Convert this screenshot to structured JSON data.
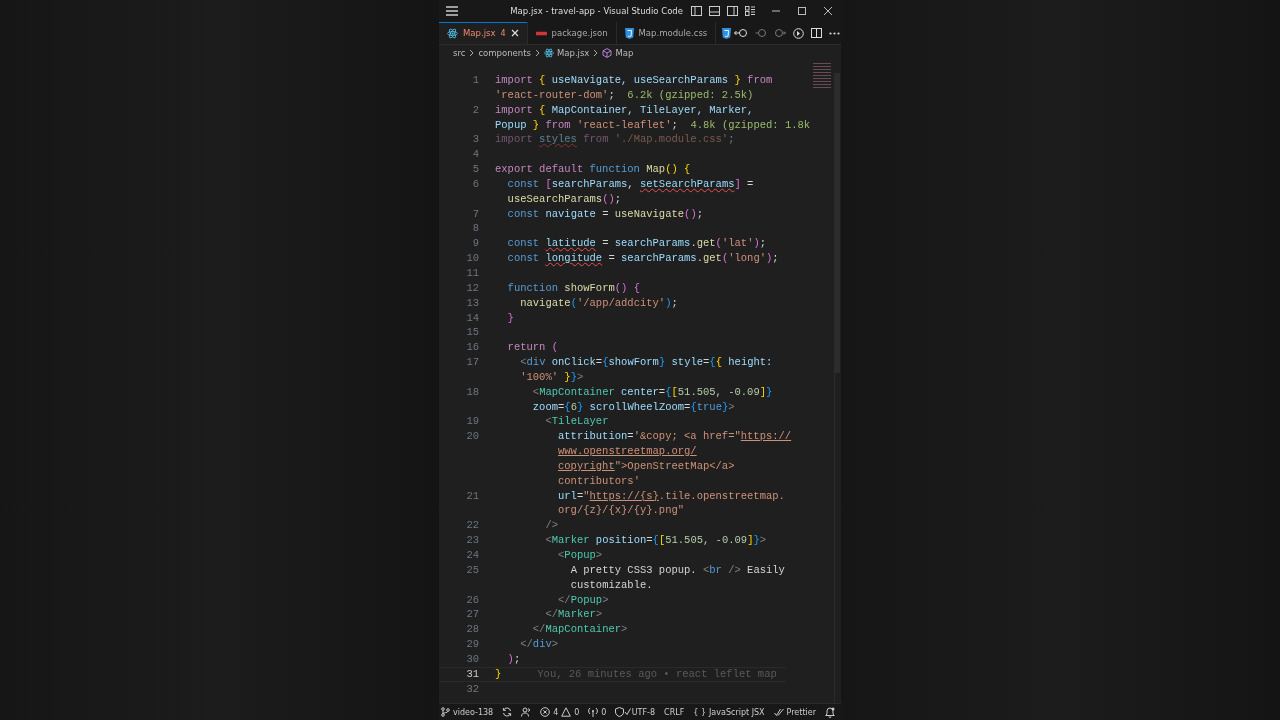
{
  "window": {
    "title": "Map.jsx - travel-app - Visual Studio Code"
  },
  "tabs": [
    {
      "label": "Map.jsx",
      "badge": "4",
      "kind": "jsx",
      "selected": true
    },
    {
      "label": "package.json",
      "kind": "json",
      "selected": false
    },
    {
      "label": "Map.module.css",
      "kind": "css",
      "selected": false
    },
    {
      "kind": "css",
      "selected": false
    }
  ],
  "breadcrumb": [
    {
      "text": "src",
      "kind": "folder"
    },
    {
      "text": "components",
      "kind": "folder"
    },
    {
      "text": "Map.jsx",
      "kind": "jsx"
    },
    {
      "text": "Map",
      "kind": "symbol"
    }
  ],
  "lines": [
    {
      "number": "1",
      "current": false,
      "rows": [
        {
          "tokens": [
            {
              "text": "import ",
              "kind": "keyword"
            },
            {
              "text": "{",
              "kind": "bracket1"
            },
            {
              "text": " useNavigate, useSearchParams ",
              "kind": "variable"
            },
            {
              "text": "}",
              "kind": "bracket1"
            },
            {
              "text": " from",
              "kind": "keyword"
            }
          ]
        },
        {
          "tokens": [
            {
              "text": "'react-router-dom'",
              "kind": "string"
            },
            {
              "text": ";",
              "kind": "plain"
            },
            {
              "text": "  6.2k (gzipped: 2.5k)",
              "kind": "hint"
            }
          ]
        }
      ]
    },
    {
      "number": "2",
      "current": false,
      "rows": [
        {
          "tokens": [
            {
              "text": "import ",
              "kind": "keyword"
            },
            {
              "text": "{",
              "kind": "bracket1"
            },
            {
              "text": " MapContainer, TileLayer, Marker,",
              "kind": "variable"
            }
          ]
        },
        {
          "tokens": [
            {
              "text": "Popup ",
              "kind": "variable"
            },
            {
              "text": "}",
              "kind": "bracket1"
            },
            {
              "text": " from ",
              "kind": "keyword"
            },
            {
              "text": "'react-leaflet'",
              "kind": "string"
            },
            {
              "text": ";",
              "kind": "plain"
            },
            {
              "text": "  4.8k (gzipped: 1.8k",
              "kind": "hint"
            }
          ]
        }
      ]
    },
    {
      "number": "3",
      "current": false,
      "faded": true,
      "rows": [
        {
          "tokens": [
            {
              "text": "import ",
              "kind": "keyword"
            },
            {
              "text": "styles",
              "kind": "error"
            },
            {
              "text": " from ",
              "kind": "keyword"
            },
            {
              "text": "'./Map.module.css'",
              "kind": "string"
            },
            {
              "text": ";",
              "kind": "plain"
            }
          ]
        }
      ]
    },
    {
      "number": "4",
      "current": false
    },
    {
      "number": "5",
      "current": false,
      "rows": [
        {
          "tokens": [
            {
              "text": "export default ",
              "kind": "keyword"
            },
            {
              "text": "function ",
              "kind": "storage"
            },
            {
              "text": "Map",
              "kind": "function"
            },
            {
              "text": "()",
              "kind": "bracket1"
            },
            {
              "text": " {",
              "kind": "bracket1"
            }
          ]
        }
      ]
    },
    {
      "number": "6",
      "current": false,
      "rows": [
        {
          "tokens": [
            {
              "text": "  const ",
              "kind": "storage"
            },
            {
              "text": "[",
              "kind": "bracket2"
            },
            {
              "text": "searchParams",
              "kind": "variable"
            },
            {
              "text": ", ",
              "kind": "plain"
            },
            {
              "text": "setSearchParams",
              "kind": "error"
            },
            {
              "text": "]",
              "kind": "bracket2"
            },
            {
              "text": " =",
              "kind": "plain"
            }
          ]
        },
        {
          "tokens": [
            {
              "text": "  useSearchParams",
              "kind": "function"
            },
            {
              "text": "()",
              "kind": "bracket2"
            },
            {
              "text": ";",
              "kind": "plain"
            }
          ]
        }
      ]
    },
    {
      "number": "7",
      "current": false,
      "rows": [
        {
          "tokens": [
            {
              "text": "  const ",
              "kind": "storage"
            },
            {
              "text": "navigate",
              "kind": "variable"
            },
            {
              "text": " = ",
              "kind": "plain"
            },
            {
              "text": "useNavigate",
              "kind": "function"
            },
            {
              "text": "()",
              "kind": "bracket2"
            },
            {
              "text": ";",
              "kind": "plain"
            }
          ]
        }
      ]
    },
    {
      "number": "8",
      "current": false
    },
    {
      "number": "9",
      "current": false,
      "rows": [
        {
          "tokens": [
            {
              "text": "  const ",
              "kind": "storage"
            },
            {
              "text": "latitude",
              "kind": "error"
            },
            {
              "text": " = ",
              "kind": "plain"
            },
            {
              "text": "searchParams",
              "kind": "variable"
            },
            {
              "text": ".",
              "kind": "plain"
            },
            {
              "text": "get",
              "kind": "function"
            },
            {
              "text": "(",
              "kind": "bracket2"
            },
            {
              "text": "'lat'",
              "kind": "string"
            },
            {
              "text": ")",
              "kind": "bracket2"
            },
            {
              "text": ";",
              "kind": "plain"
            }
          ]
        }
      ]
    },
    {
      "number": "10",
      "current": false,
      "rows": [
        {
          "tokens": [
            {
              "text": "  const ",
              "kind": "storage"
            },
            {
              "text": "longitude",
              "kind": "error"
            },
            {
              "text": " = ",
              "kind": "plain"
            },
            {
              "text": "searchParams",
              "kind": "variable"
            },
            {
              "text": ".",
              "kind": "plain"
            },
            {
              "text": "get",
              "kind": "function"
            },
            {
              "text": "(",
              "kind": "bracket2"
            },
            {
              "text": "'long'",
              "kind": "string"
            },
            {
              "text": ")",
              "kind": "bracket2"
            },
            {
              "text": ";",
              "kind": "plain"
            }
          ]
        }
      ]
    },
    {
      "number": "11",
      "current": false
    },
    {
      "number": "12",
      "current": false,
      "rows": [
        {
          "tokens": [
            {
              "text": "  function ",
              "kind": "storage"
            },
            {
              "text": "showForm",
              "kind": "function"
            },
            {
              "text": "()",
              "kind": "bracket2"
            },
            {
              "text": " {",
              "kind": "bracket2"
            }
          ]
        }
      ]
    },
    {
      "number": "13",
      "current": false,
      "rows": [
        {
          "tokens": [
            {
              "text": "    navigate",
              "kind": "function"
            },
            {
              "text": "(",
              "kind": "bracket3"
            },
            {
              "text": "'/app/addcity'",
              "kind": "string"
            },
            {
              "text": ")",
              "kind": "bracket3"
            },
            {
              "text": ";",
              "kind": "plain"
            }
          ]
        }
      ]
    },
    {
      "number": "14",
      "current": false,
      "rows": [
        {
          "tokens": [
            {
              "text": "  }",
              "kind": "bracket2"
            }
          ]
        }
      ]
    },
    {
      "number": "15",
      "current": false
    },
    {
      "number": "16",
      "current": false,
      "rows": [
        {
          "tokens": [
            {
              "text": "  return ",
              "kind": "keyword"
            },
            {
              "text": "(",
              "kind": "bracket2"
            }
          ]
        }
      ]
    },
    {
      "number": "17",
      "current": false,
      "rows": [
        {
          "tokens": [
            {
              "text": "    <",
              "kind": "tagmark"
            },
            {
              "text": "div ",
              "kind": "htmltag"
            },
            {
              "text": "onClick",
              "kind": "variable"
            },
            {
              "text": "=",
              "kind": "plain"
            },
            {
              "text": "{",
              "kind": "bracket3"
            },
            {
              "text": "showForm",
              "kind": "variable"
            },
            {
              "text": "}",
              "kind": "bracket3"
            },
            {
              "text": " style",
              "kind": "variable"
            },
            {
              "text": "=",
              "kind": "plain"
            },
            {
              "text": "{",
              "kind": "bracket3"
            },
            {
              "text": "{",
              "kind": "bracket1"
            },
            {
              "text": " height:",
              "kind": "variable"
            }
          ]
        },
        {
          "tokens": [
            {
              "text": "    '100%'",
              "kind": "string"
            },
            {
              "text": " }",
              "kind": "bracket1"
            },
            {
              "text": "}",
              "kind": "bracket3"
            },
            {
              "text": ">",
              "kind": "tagmark"
            }
          ]
        }
      ]
    },
    {
      "number": "18",
      "current": false,
      "rows": [
        {
          "tokens": [
            {
              "text": "      <",
              "kind": "tagmark"
            },
            {
              "text": "MapContainer ",
              "kind": "component"
            },
            {
              "text": "center",
              "kind": "variable"
            },
            {
              "text": "=",
              "kind": "plain"
            },
            {
              "text": "{",
              "kind": "bracket3"
            },
            {
              "text": "[",
              "kind": "bracket1"
            },
            {
              "text": "51.505, -0.09",
              "kind": "number"
            },
            {
              "text": "]",
              "kind": "bracket1"
            },
            {
              "text": "}",
              "kind": "bracket3"
            }
          ]
        },
        {
          "tokens": [
            {
              "text": "      zoom",
              "kind": "variable"
            },
            {
              "text": "=",
              "kind": "plain"
            },
            {
              "text": "{",
              "kind": "bracket3"
            },
            {
              "text": "6",
              "kind": "number"
            },
            {
              "text": "}",
              "kind": "bracket3"
            },
            {
              "text": " scrollWheelZoom",
              "kind": "variable"
            },
            {
              "text": "=",
              "kind": "plain"
            },
            {
              "text": "{",
              "kind": "bracket3"
            },
            {
              "text": "true",
              "kind": "storage"
            },
            {
              "text": "}",
              "kind": "bracket3"
            },
            {
              "text": ">",
              "kind": "tagmark"
            }
          ]
        }
      ]
    },
    {
      "number": "19",
      "current": false,
      "rows": [
        {
          "tokens": [
            {
              "text": "        <",
              "kind": "tagmark"
            },
            {
              "text": "TileLayer",
              "kind": "component"
            }
          ]
        }
      ]
    },
    {
      "number": "20",
      "current": false,
      "rows": [
        {
          "tokens": [
            {
              "text": "          attribution",
              "kind": "variable"
            },
            {
              "text": "=",
              "kind": "plain"
            },
            {
              "text": "'&copy; <a href=\"",
              "kind": "string"
            },
            {
              "text": "https://",
              "kind": "link"
            }
          ]
        },
        {
          "tokens": [
            {
              "text": "          www.openstreetmap.org/",
              "kind": "link"
            }
          ]
        },
        {
          "tokens": [
            {
              "text": "          copyright",
              "kind": "link"
            },
            {
              "text": "\">OpenStreetMap</a>",
              "kind": "string"
            }
          ]
        },
        {
          "tokens": [
            {
              "text": "          contributors'",
              "kind": "string"
            }
          ]
        }
      ]
    },
    {
      "number": "21",
      "current": false,
      "rows": [
        {
          "tokens": [
            {
              "text": "          url",
              "kind": "variable"
            },
            {
              "text": "=",
              "kind": "plain"
            },
            {
              "text": "\"",
              "kind": "string"
            },
            {
              "text": "https://{s}",
              "kind": "link"
            },
            {
              "text": ".tile.openstreetmap.",
              "kind": "string"
            }
          ]
        },
        {
          "tokens": [
            {
              "text": "          org/{z}/{x}/{y}.png\"",
              "kind": "string"
            }
          ]
        }
      ]
    },
    {
      "number": "22",
      "current": false,
      "rows": [
        {
          "tokens": [
            {
              "text": "        />",
              "kind": "tagmark"
            }
          ]
        }
      ]
    },
    {
      "number": "23",
      "current": false,
      "rows": [
        {
          "tokens": [
            {
              "text": "        <",
              "kind": "tagmark"
            },
            {
              "text": "Marker ",
              "kind": "component"
            },
            {
              "text": "position",
              "kind": "variable"
            },
            {
              "text": "=",
              "kind": "plain"
            },
            {
              "text": "{",
              "kind": "bracket3"
            },
            {
              "text": "[",
              "kind": "bracket1"
            },
            {
              "text": "51.505, -0.09",
              "kind": "number"
            },
            {
              "text": "]",
              "kind": "bracket1"
            },
            {
              "text": "}",
              "kind": "bracket3"
            },
            {
              "text": ">",
              "kind": "tagmark"
            }
          ]
        }
      ]
    },
    {
      "number": "24",
      "current": false,
      "rows": [
        {
          "tokens": [
            {
              "text": "          <",
              "kind": "tagmark"
            },
            {
              "text": "Popup",
              "kind": "component"
            },
            {
              "text": ">",
              "kind": "tagmark"
            }
          ]
        }
      ]
    },
    {
      "number": "25",
      "current": false,
      "rows": [
        {
          "tokens": [
            {
              "text": "            A pretty CSS3 popup. ",
              "kind": "plain"
            },
            {
              "text": "<",
              "kind": "tagmark"
            },
            {
              "text": "br ",
              "kind": "htmltag"
            },
            {
              "text": "/>",
              "kind": "tagmark"
            },
            {
              "text": " Easily",
              "kind": "plain"
            }
          ]
        },
        {
          "tokens": [
            {
              "text": "            customizable.",
              "kind": "plain"
            }
          ]
        }
      ]
    },
    {
      "number": "26",
      "current": false,
      "rows": [
        {
          "tokens": [
            {
              "text": "          </",
              "kind": "tagmark"
            },
            {
              "text": "Popup",
              "kind": "component"
            },
            {
              "text": ">",
              "kind": "tagmark"
            }
          ]
        }
      ]
    },
    {
      "number": "27",
      "current": false,
      "rows": [
        {
          "tokens": [
            {
              "text": "        </",
              "kind": "tagmark"
            },
            {
              "text": "Marker",
              "kind": "component"
            },
            {
              "text": ">",
              "kind": "tagmark"
            }
          ]
        }
      ]
    },
    {
      "number": "28",
      "current": false,
      "rows": [
        {
          "tokens": [
            {
              "text": "      </",
              "kind": "tagmark"
            },
            {
              "text": "MapContainer",
              "kind": "component"
            },
            {
              "text": ">",
              "kind": "tagmark"
            }
          ]
        }
      ]
    },
    {
      "number": "29",
      "current": false,
      "rows": [
        {
          "tokens": [
            {
              "text": "    </",
              "kind": "tagmark"
            },
            {
              "text": "div",
              "kind": "htmltag"
            },
            {
              "text": ">",
              "kind": "tagmark"
            }
          ]
        }
      ]
    },
    {
      "number": "30",
      "current": false,
      "rows": [
        {
          "tokens": [
            {
              "text": "  )",
              "kind": "bracket2"
            },
            {
              "text": ";",
              "kind": "plain"
            }
          ]
        }
      ]
    },
    {
      "number": "31",
      "current": true,
      "blame": "You, 26 minutes ago • react leflet map",
      "rows": [
        {
          "tokens": [
            {
              "text": "}",
              "kind": "bracket1"
            }
          ]
        }
      ]
    },
    {
      "number": "32",
      "current": false
    }
  ],
  "status_bar": {
    "left": [
      {
        "kind": "branch",
        "text": "video-138"
      },
      {
        "kind": "sync"
      },
      {
        "kind": "liveshare"
      },
      {
        "kind": "problems",
        "errors": "4",
        "warnings": "0"
      },
      {
        "kind": "ports",
        "text": "0"
      },
      {
        "kind": "shield"
      }
    ],
    "right": [
      {
        "kind": "plain",
        "text": "UTF-8"
      },
      {
        "kind": "plain",
        "text": "CRLF"
      },
      {
        "kind": "language",
        "glyph": "{ }",
        "text": "JavaScript JSX"
      },
      {
        "kind": "prettier",
        "text": "Prettier"
      },
      {
        "kind": "bell"
      }
    ]
  }
}
